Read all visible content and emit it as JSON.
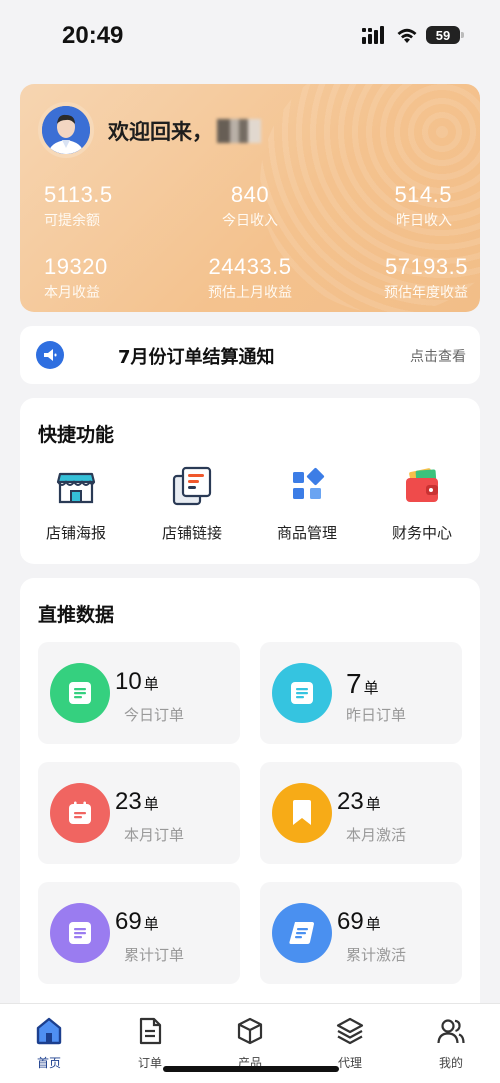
{
  "status_bar": {
    "time": "20:49",
    "battery": "59"
  },
  "header": {
    "welcome": "欢迎回来，",
    "stats_row1": [
      {
        "value": "5113.5",
        "label": "可提余额"
      },
      {
        "value": "840",
        "label": "今日收入"
      },
      {
        "value": "514.5",
        "label": "昨日收入"
      }
    ],
    "stats_row2": [
      {
        "value": "19320",
        "label": "本月收益"
      },
      {
        "value": "24433.5",
        "label": "预估上月收益"
      },
      {
        "value": "57193.5",
        "label": "预估年度收益"
      }
    ]
  },
  "notice": {
    "title": "7月份订单结算通知",
    "link": "点击查看"
  },
  "quick": {
    "title": "快捷功能",
    "items": [
      {
        "label": "店铺海报",
        "icon": "storefront-icon"
      },
      {
        "label": "店铺链接",
        "icon": "link-cards-icon"
      },
      {
        "label": "商品管理",
        "icon": "grid-boxes-icon"
      },
      {
        "label": "财务中心",
        "icon": "wallet-icon"
      }
    ]
  },
  "direct": {
    "title": "直推数据",
    "unit": "单",
    "tiles": [
      {
        "value": "10",
        "label": "今日订单",
        "color": "#35d07f",
        "icon": "document-icon"
      },
      {
        "value": "7",
        "label": "昨日订单",
        "color": "#35c4e0",
        "icon": "document-icon"
      },
      {
        "value": "23",
        "label": "本月订单",
        "color": "#f06561",
        "icon": "calendar-icon"
      },
      {
        "value": "23",
        "label": "本月激活",
        "color": "#f7ab17",
        "icon": "bookmark-icon"
      },
      {
        "value": "69",
        "label": "累计订单",
        "color": "#9a7cf0",
        "icon": "document-icon"
      },
      {
        "value": "69",
        "label": "累计激活",
        "color": "#4a90f0",
        "icon": "scroll-icon"
      }
    ]
  },
  "tabbar": [
    {
      "label": "首页",
      "icon": "home-icon",
      "active": true
    },
    {
      "label": "订单",
      "icon": "order-document-icon",
      "active": false
    },
    {
      "label": "产品",
      "icon": "box-icon",
      "active": false
    },
    {
      "label": "代理",
      "icon": "layers-icon",
      "active": false
    },
    {
      "label": "我的",
      "icon": "users-icon",
      "active": false
    }
  ],
  "colors": {
    "accent": "#1c3f8e",
    "hero": "#f4c28e",
    "notice_icon": "#2f6fe0"
  }
}
